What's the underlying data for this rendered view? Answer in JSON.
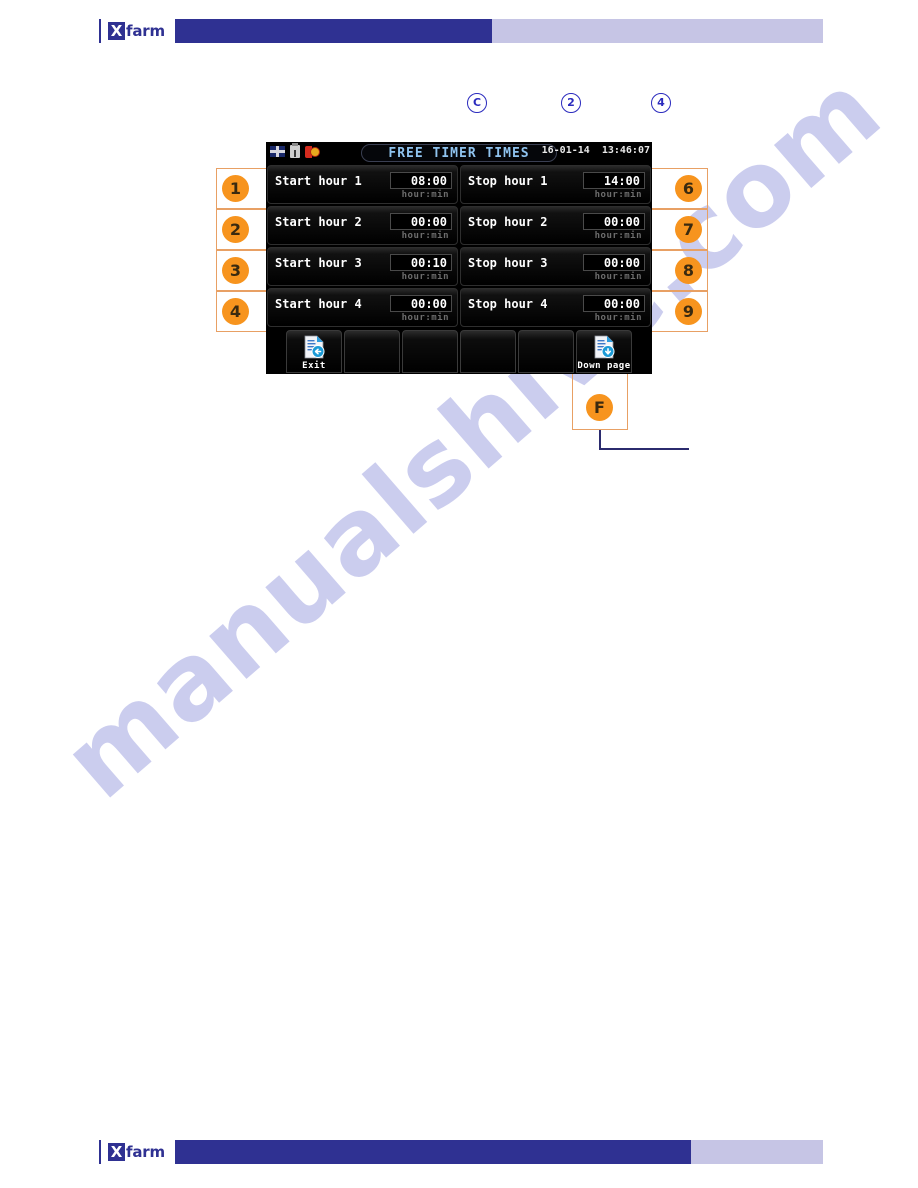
{
  "branding": {
    "logo_mark": "X",
    "logo_word": "farm"
  },
  "watermark": {
    "text": "manualshive.com"
  },
  "top_markers": [
    {
      "label": "C"
    },
    {
      "label": "2"
    },
    {
      "label": "4"
    }
  ],
  "left_callouts": [
    {
      "label": "1"
    },
    {
      "label": "2"
    },
    {
      "label": "3"
    },
    {
      "label": "4"
    }
  ],
  "right_callouts": [
    {
      "label": "6"
    },
    {
      "label": "7"
    },
    {
      "label": "8"
    },
    {
      "label": "9"
    }
  ],
  "bottom_callout": {
    "label": "F"
  },
  "device": {
    "status_icons": [
      {
        "name": "uk-flag-icon"
      },
      {
        "name": "usb-drive-icon"
      },
      {
        "name": "alarm-icon"
      }
    ],
    "title": "FREE TIMER TIMES",
    "date": "16-01-14",
    "time": "13:46:07",
    "rows": [
      {
        "start": {
          "label": "Start hour 1",
          "value": "08:00",
          "unit": "hour:min"
        },
        "stop": {
          "label": "Stop hour 1",
          "value": "14:00",
          "unit": "hour:min"
        }
      },
      {
        "start": {
          "label": "Start hour 2",
          "value": "00:00",
          "unit": "hour:min"
        },
        "stop": {
          "label": "Stop hour 2",
          "value": "00:00",
          "unit": "hour:min"
        }
      },
      {
        "start": {
          "label": "Start hour 3",
          "value": "00:10",
          "unit": "hour:min"
        },
        "stop": {
          "label": "Stop hour 3",
          "value": "00:00",
          "unit": "hour:min"
        }
      },
      {
        "start": {
          "label": "Start hour 4",
          "value": "00:00",
          "unit": "hour:min"
        },
        "stop": {
          "label": "Stop hour 4",
          "value": "00:00",
          "unit": "hour:min"
        }
      }
    ],
    "toolbar": [
      {
        "label": "Exit",
        "icon": "document-back-arrow-icon"
      },
      {
        "label": "",
        "icon": ""
      },
      {
        "label": "",
        "icon": ""
      },
      {
        "label": "",
        "icon": ""
      },
      {
        "label": "",
        "icon": ""
      },
      {
        "label": "Down page",
        "icon": "document-down-arrow-icon"
      }
    ]
  },
  "colors": {
    "brand_dark_blue": "#2f3192",
    "brand_light_blue": "#c6c5e5",
    "callout_orange": "#f7941e",
    "callout_border": "#e8a064",
    "marker_blue": "#2b2bbe",
    "screen_title_blue": "#8fc3ef",
    "leader_line": "#2b2b6e"
  }
}
